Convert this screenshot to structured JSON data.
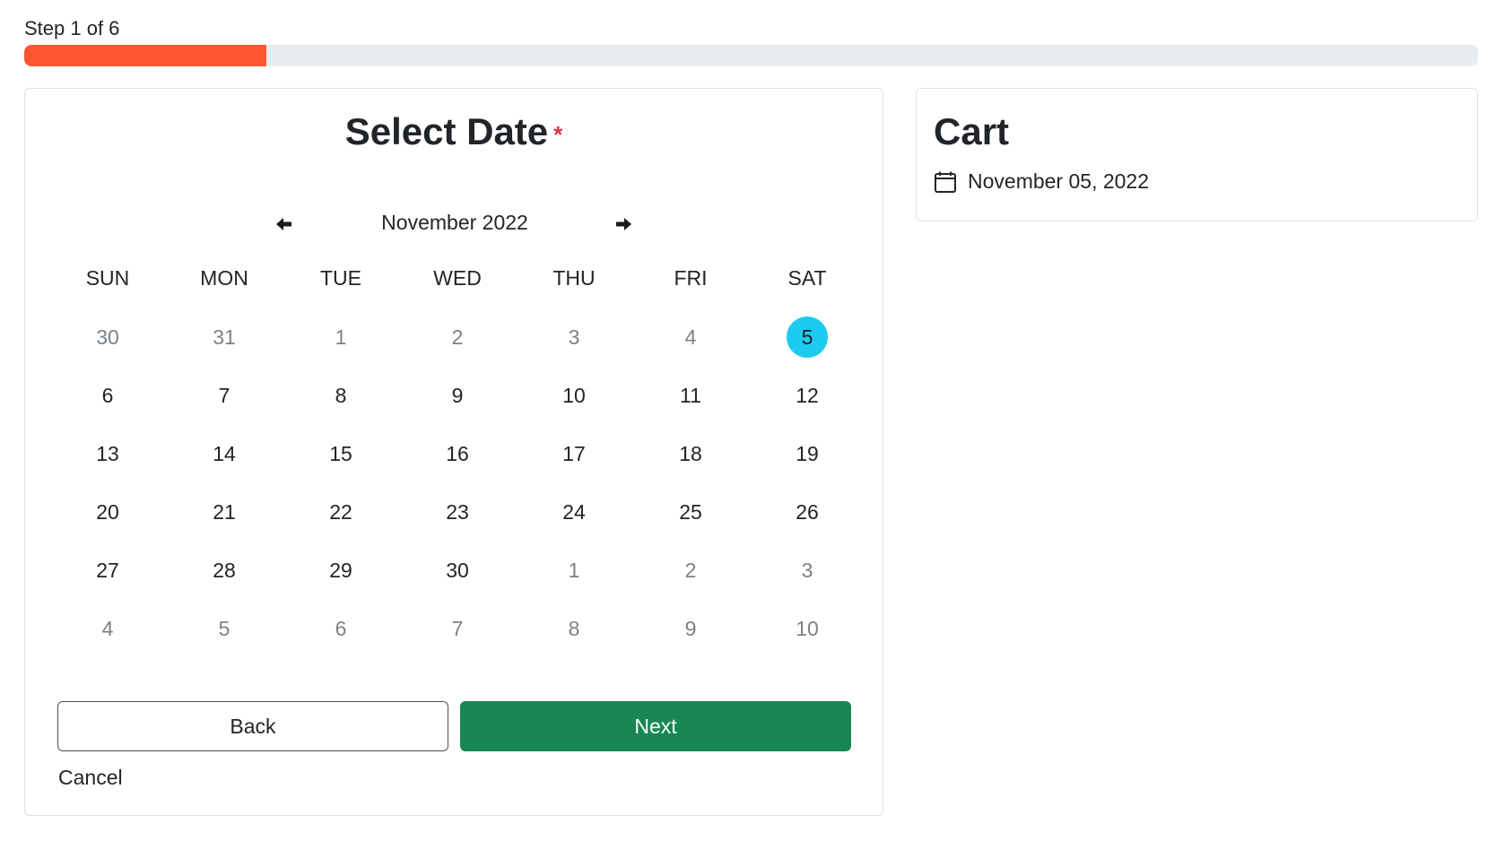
{
  "progress": {
    "label": "Step 1 of 6",
    "fraction": 0.1667,
    "color": "#fd5631"
  },
  "date_picker": {
    "title": "Select Date",
    "required_marker": "*",
    "month_label": "November 2022",
    "prev_icon": "arrow-left-icon",
    "next_icon": "arrow-right-icon",
    "weekdays": [
      "SUN",
      "MON",
      "TUE",
      "WED",
      "THU",
      "FRI",
      "SAT"
    ],
    "weeks": [
      [
        {
          "d": "30",
          "o": true
        },
        {
          "d": "31",
          "o": true
        },
        {
          "d": "1",
          "o": true
        },
        {
          "d": "2",
          "o": true
        },
        {
          "d": "3",
          "o": true
        },
        {
          "d": "4",
          "o": true
        },
        {
          "d": "5",
          "o": false,
          "s": true
        }
      ],
      [
        {
          "d": "6"
        },
        {
          "d": "7"
        },
        {
          "d": "8"
        },
        {
          "d": "9"
        },
        {
          "d": "10"
        },
        {
          "d": "11"
        },
        {
          "d": "12"
        }
      ],
      [
        {
          "d": "13"
        },
        {
          "d": "14"
        },
        {
          "d": "15"
        },
        {
          "d": "16"
        },
        {
          "d": "17"
        },
        {
          "d": "18"
        },
        {
          "d": "19"
        }
      ],
      [
        {
          "d": "20"
        },
        {
          "d": "21"
        },
        {
          "d": "22"
        },
        {
          "d": "23"
        },
        {
          "d": "24"
        },
        {
          "d": "25"
        },
        {
          "d": "26"
        }
      ],
      [
        {
          "d": "27"
        },
        {
          "d": "28"
        },
        {
          "d": "29"
        },
        {
          "d": "30"
        },
        {
          "d": "1",
          "o": true
        },
        {
          "d": "2",
          "o": true
        },
        {
          "d": "3",
          "o": true
        }
      ],
      [
        {
          "d": "4",
          "o": true
        },
        {
          "d": "5",
          "o": true
        },
        {
          "d": "6",
          "o": true
        },
        {
          "d": "7",
          "o": true
        },
        {
          "d": "8",
          "o": true
        },
        {
          "d": "9",
          "o": true
        },
        {
          "d": "10",
          "o": true
        }
      ]
    ],
    "selected_color": "#1ecbf0",
    "back_label": "Back",
    "next_label": "Next",
    "next_color": "#198754",
    "cancel_label": "Cancel"
  },
  "cart": {
    "title": "Cart",
    "item_icon": "calendar-icon",
    "item_date": "November 05, 2022"
  }
}
